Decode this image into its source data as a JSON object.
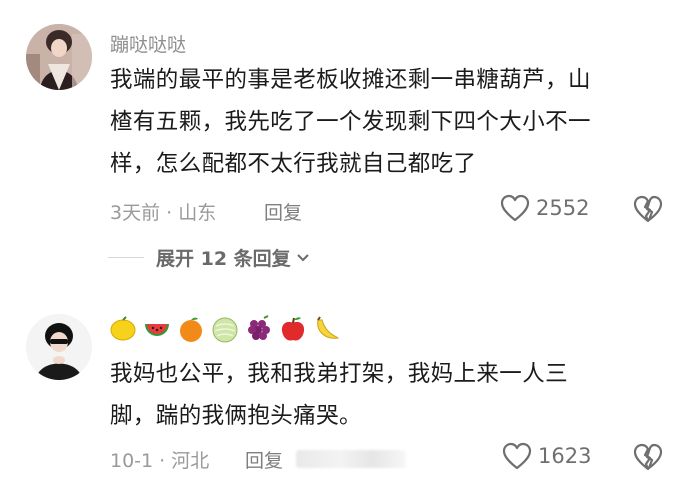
{
  "comments": [
    {
      "username": "蹦哒哒哒",
      "lines": [
        "我端的最平的事是老板收摊还剩一串糖葫芦，山",
        "楂有五颗，我先吃了一个发现剩下四个大小不一",
        "样，怎么配都不太行我就自己都吃了"
      ],
      "meta": "3天前 · 山东",
      "reply_label": "回复",
      "like_count": "2552",
      "expand_label": "展开 12 条回复"
    },
    {
      "emojis": [
        "lemon",
        "watermelon",
        "orange",
        "melon",
        "grapes",
        "apple",
        "banana"
      ],
      "lines": [
        "我妈也公平，我和我弟打架，我妈上来一人三",
        "脚，踹的我俩抱头痛哭。"
      ],
      "meta": "10-1 · 河北",
      "reply_label": "回复",
      "like_count": "1623"
    }
  ],
  "colors": {
    "meta": "#9a9a9a",
    "text": "#1b1b1b",
    "icon": "#6f6f6f"
  }
}
